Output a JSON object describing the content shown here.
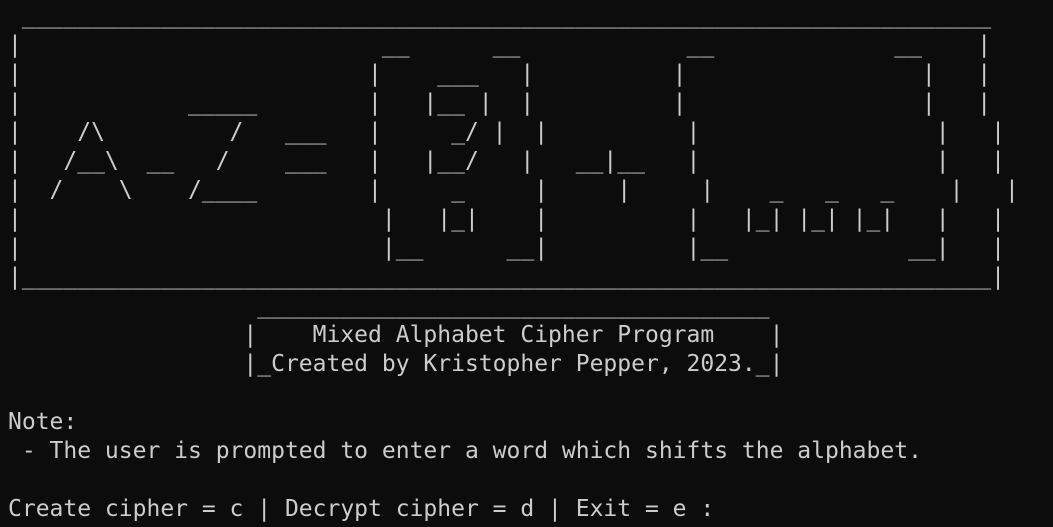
{
  "banner": {
    "ascii_art": " ______________________________________________________________________\n|                          __      __            __             __    |\n|                         |    ___   |          |                 |   |\n|            _____        |   |__ |  |          |                 |   |\n|    /\\         /   ___   |     _/ |  |          |                 |   |\n|   /__\\  __   /    ___   |   |__/   |   __|__   |                 |   |\n|  /    \\    /____        |     _     |     |     |    _   _   _    |   |\n|                          |   |_|    |          |   |_| |_| |_|   |   |\n|                          |__      __|          |__             __|   |\n|______________________________________________________________________|"
  },
  "program_box": {
    "top_border": "                  _____________________________________",
    "title_line": "                 |    Mixed Alphabet Cipher Program    |",
    "author_line": "                 |_Created by Kristopher Pepper, 2023._|"
  },
  "note": {
    "label": "Note:",
    "text": " - The user is prompted to enter a word which shifts the alphabet."
  },
  "menu": {
    "prompt": "Create cipher = c | Decrypt cipher = d | Exit = e :"
  }
}
